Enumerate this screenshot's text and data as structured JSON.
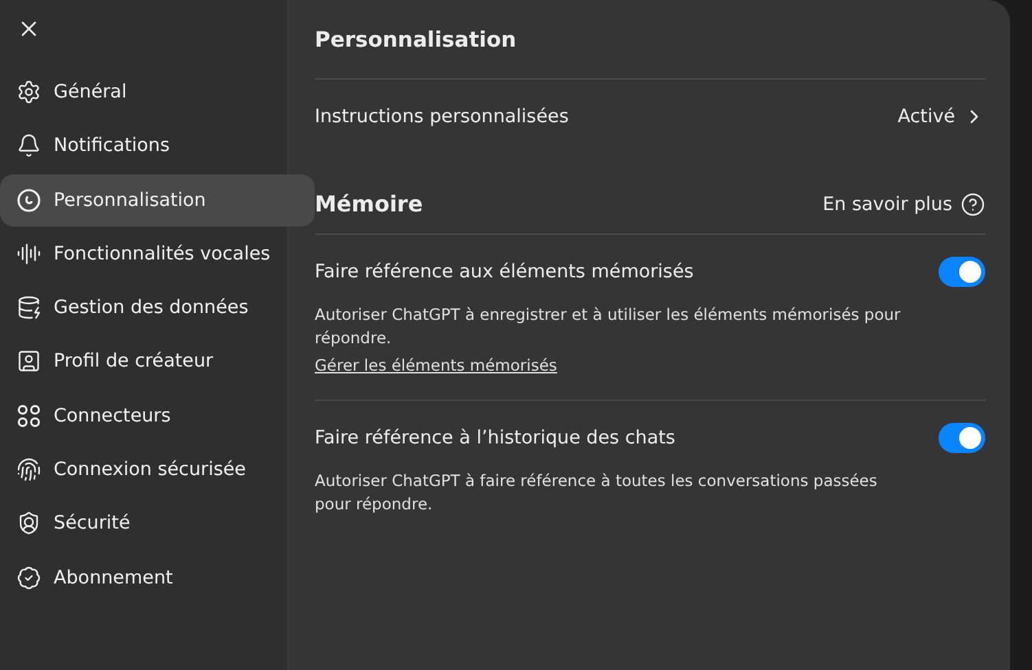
{
  "sidebar": {
    "items": [
      {
        "label": "Général",
        "selected": false
      },
      {
        "label": "Notifications",
        "selected": false
      },
      {
        "label": "Personnalisation",
        "selected": true
      },
      {
        "label": "Fonctionnalités vocales",
        "selected": false
      },
      {
        "label": "Gestion des données",
        "selected": false
      },
      {
        "label": "Profil de créateur",
        "selected": false
      },
      {
        "label": "Connecteurs",
        "selected": false
      },
      {
        "label": "Connexion sécurisée",
        "selected": false
      },
      {
        "label": "Sécurité",
        "selected": false
      },
      {
        "label": "Abonnement",
        "selected": false
      }
    ]
  },
  "panel": {
    "title": "Personnalisation",
    "custom_instructions": {
      "label": "Instructions personnalisées",
      "value": "Activé"
    },
    "memory": {
      "title": "Mémoire",
      "learn_more": "En savoir plus",
      "settings": [
        {
          "label": "Faire référence aux éléments mémorisés",
          "on": true,
          "description": "Autoriser ChatGPT à enregistrer et à utiliser les éléments mémorisés pour répondre.",
          "link": "Gérer les éléments mémorisés"
        },
        {
          "label": "Faire référence à l’historique des chats",
          "on": true,
          "description": "Autoriser ChatGPT à faire référence à toutes les conversations passées pour répondre."
        }
      ]
    }
  }
}
